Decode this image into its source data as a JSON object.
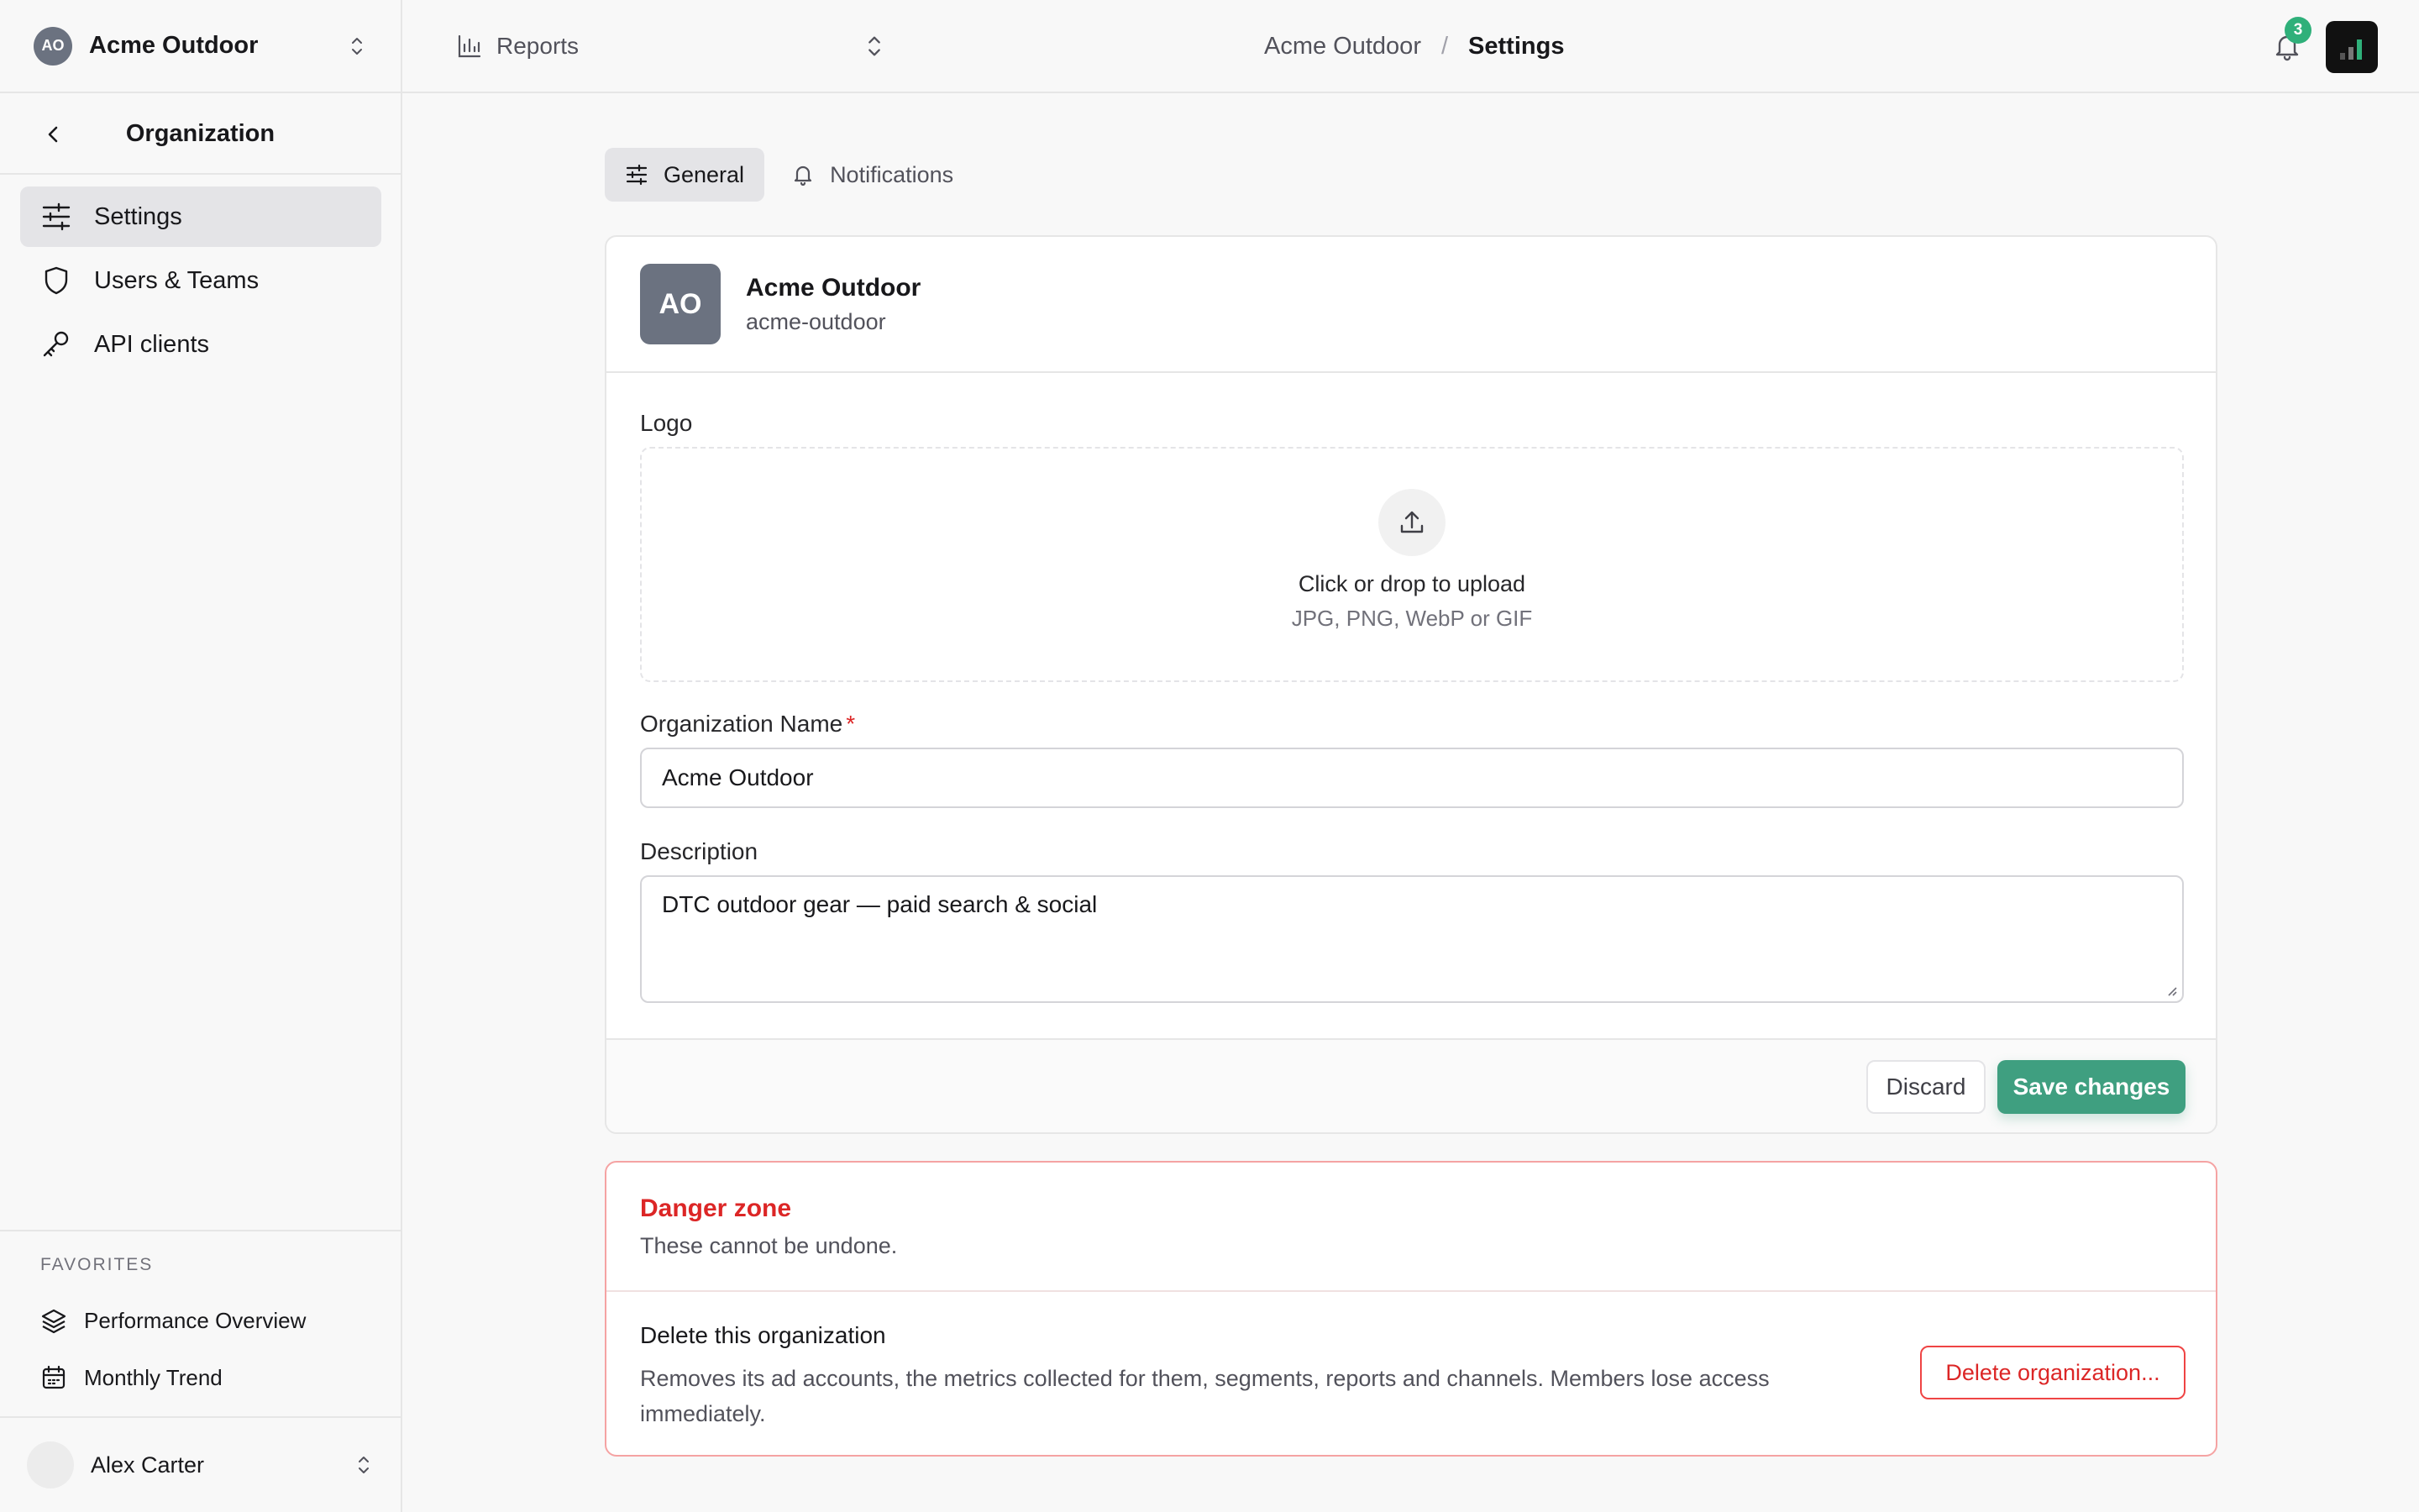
{
  "org_switcher": {
    "initials": "AO",
    "name": "Acme Outdoor"
  },
  "sidebar": {
    "title": "Organization",
    "items": [
      {
        "label": "Settings",
        "icon": "sliders-icon",
        "active": true
      },
      {
        "label": "Users & Teams",
        "icon": "shield-icon",
        "active": false
      },
      {
        "label": "API clients",
        "icon": "key-icon",
        "active": false
      }
    ],
    "favorites_heading": "FAVORITES",
    "favorites": [
      {
        "label": "Performance Overview",
        "icon": "layers-icon"
      },
      {
        "label": "Monthly Trend",
        "icon": "calendar-icon"
      }
    ],
    "user": {
      "name": "Alex Carter"
    }
  },
  "topbar": {
    "reports_label": "Reports",
    "breadcrumb": {
      "parent": "Acme Outdoor",
      "separator": "/",
      "current": "Settings"
    },
    "notification_count": "3"
  },
  "tabs": [
    {
      "label": "General",
      "active": true
    },
    {
      "label": "Notifications",
      "active": false
    }
  ],
  "org_card": {
    "initials": "AO",
    "name": "Acme Outdoor",
    "slug": "acme-outdoor",
    "logo_label": "Logo",
    "upload_main": "Click or drop to upload",
    "upload_formats": "JPG, PNG, WebP or GIF",
    "name_label": "Organization Name",
    "required_mark": "*",
    "name_value": "Acme Outdoor",
    "description_label": "Description",
    "description_value": "DTC outdoor gear — paid search & social",
    "discard_label": "Discard",
    "save_label": "Save changes"
  },
  "danger_zone": {
    "title": "Danger zone",
    "subtitle": "These cannot be undone.",
    "delete_title": "Delete this organization",
    "delete_text": "Removes its ad accounts, the metrics collected for them, segments, reports and channels. Members lose access immediately.",
    "delete_button": "Delete organization..."
  },
  "colors": {
    "accent": "#3f9f80",
    "danger": "#dc2626",
    "badge": "#2fb07a",
    "avatar": "#6b7280"
  }
}
